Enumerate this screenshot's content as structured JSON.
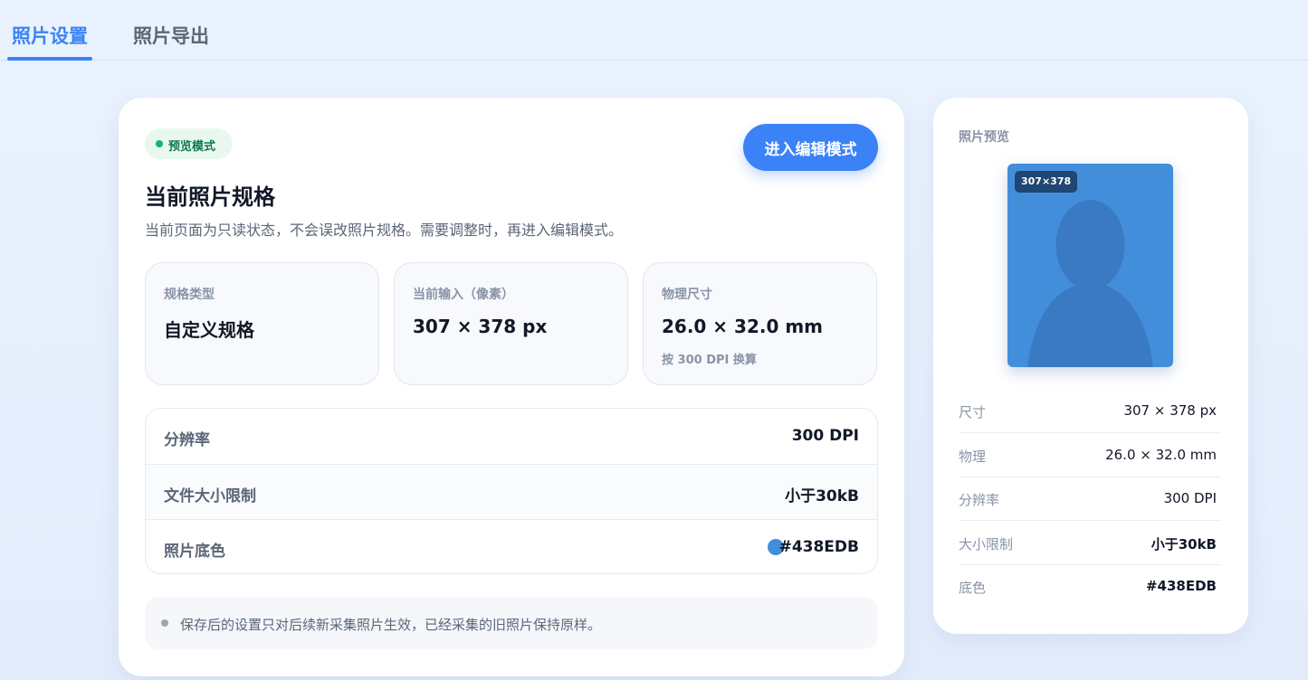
{
  "tabs": [
    {
      "label": "照片设置",
      "active": true
    },
    {
      "label": "照片导出",
      "active": false
    }
  ],
  "main": {
    "badge": "预览模式",
    "edit_button": "进入编辑模式",
    "title": "当前照片规格",
    "description": "当前页面为只读状态，不会误改照片规格。需要调整时，再进入编辑模式。",
    "stats": [
      {
        "label": "规格类型",
        "value": "自定义规格",
        "note": ""
      },
      {
        "label": "当前输入（像素）",
        "value": "307 × 378 px",
        "note": ""
      },
      {
        "label": "物理尺寸",
        "value": "26.0 × 32.0 mm",
        "note": "按 300 DPI 换算"
      }
    ],
    "rows": [
      {
        "label": "分辨率",
        "value": "300 DPI"
      },
      {
        "label": "文件大小限制",
        "value": "小于30kB"
      },
      {
        "label": "照片底色",
        "value": "#438EDB"
      }
    ],
    "notice": "保存后的设置只对后续新采集照片生效，已经采集的旧照片保持原样。"
  },
  "preview": {
    "title": "照片预览",
    "size_tag": "307×378",
    "info": [
      {
        "label": "尺寸",
        "value": "307 × 378 px"
      },
      {
        "label": "物理",
        "value": "26.0 × 32.0 mm"
      },
      {
        "label": "分辨率",
        "value": "300 DPI"
      },
      {
        "label": "大小限制",
        "value": "小于30kB"
      },
      {
        "label": "底色",
        "value": "#438EDB"
      }
    ]
  },
  "colors": {
    "accent": "#3B82F6",
    "photo_background": "#438EDB",
    "silhouette": "#3A7AC2",
    "badge_dot": "#16B46A"
  },
  "icons": {
    "status_dot": "status-dot-icon",
    "color_swatch": "color-swatch-icon",
    "notice_bullet": "bullet-icon",
    "silhouette": "person-silhouette-icon"
  }
}
